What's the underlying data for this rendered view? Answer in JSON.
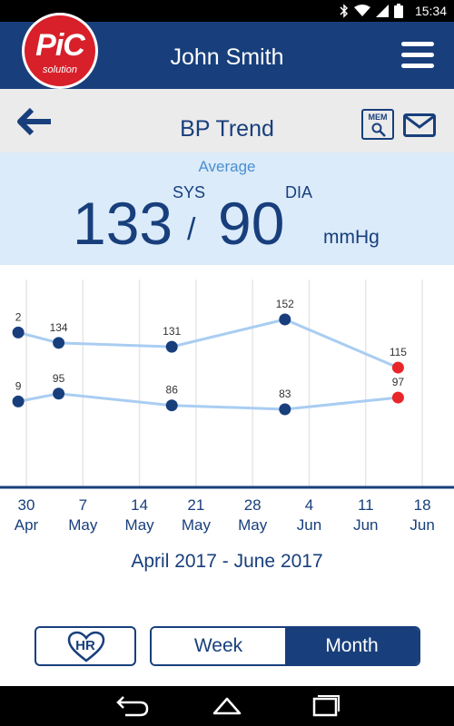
{
  "status_bar": {
    "time": "15:34",
    "icons": [
      "bluetooth-icon",
      "wifi-icon",
      "signal-icon",
      "battery-icon"
    ]
  },
  "header": {
    "logo": {
      "brand": "PiC",
      "tagline": "solution"
    },
    "title": "John Smith",
    "menu_icon": "hamburger-menu-icon"
  },
  "toolbar": {
    "back_icon": "back-arrow-icon",
    "title": "BP Trend",
    "memory_button": {
      "label": "MEM",
      "icon": "magnifier-icon"
    },
    "mail_icon": "envelope-icon"
  },
  "average": {
    "label": "Average",
    "sys_label": "SYS",
    "dia_label": "DIA",
    "sys_value": "133",
    "separator": "/",
    "dia_value": "90",
    "unit": "mmHg"
  },
  "chart_data": {
    "type": "line",
    "x_ticks": [
      {
        "day": "30",
        "month": "Apr"
      },
      {
        "day": "7",
        "month": "May"
      },
      {
        "day": "14",
        "month": "May"
      },
      {
        "day": "21",
        "month": "May"
      },
      {
        "day": "28",
        "month": "May"
      },
      {
        "day": "4",
        "month": "Jun"
      },
      {
        "day": "11",
        "month": "Jun"
      },
      {
        "day": "18",
        "month": "Jun"
      }
    ],
    "series": [
      {
        "points": [
          {
            "x": "2017-04-29",
            "y": 142,
            "label": "2",
            "color": "#183f7c"
          },
          {
            "x": "2017-05-04",
            "y": 134,
            "label": "134",
            "color": "#183f7c"
          },
          {
            "x": "2017-05-18",
            "y": 131,
            "label": "131",
            "color": "#183f7c"
          },
          {
            "x": "2017-06-01",
            "y": 152,
            "label": "152",
            "color": "#183f7c"
          },
          {
            "x": "2017-06-15",
            "y": 115,
            "label": "115",
            "color": "#e8262a"
          }
        ]
      },
      {
        "points": [
          {
            "x": "2017-04-29",
            "y": 89,
            "label": "9",
            "color": "#183f7c"
          },
          {
            "x": "2017-05-04",
            "y": 95,
            "label": "95",
            "color": "#183f7c"
          },
          {
            "x": "2017-05-18",
            "y": 86,
            "label": "86",
            "color": "#183f7c"
          },
          {
            "x": "2017-06-01",
            "y": 83,
            "label": "83",
            "color": "#183f7c"
          },
          {
            "x": "2017-06-15",
            "y": 92,
            "label": "97",
            "color": "#e8262a"
          }
        ]
      }
    ],
    "date_range": "April 2017 - June 2017",
    "grid": "vertical",
    "colors": {
      "line": "#a9cdf2",
      "point": "#183f7c",
      "highlight": "#e8262a",
      "axis": "#183f7c"
    }
  },
  "controls": {
    "hr_button": {
      "label": "HR",
      "icon": "heart-icon"
    },
    "period_toggle": [
      {
        "label": "Week",
        "selected": false
      },
      {
        "label": "Month",
        "selected": true
      }
    ]
  },
  "nav_bar": [
    "back-nav-icon",
    "home-nav-icon",
    "recents-nav-icon"
  ],
  "colors": {
    "primary": "#183f7c",
    "accent": "#d8202a",
    "panel": "#dbebfa"
  }
}
